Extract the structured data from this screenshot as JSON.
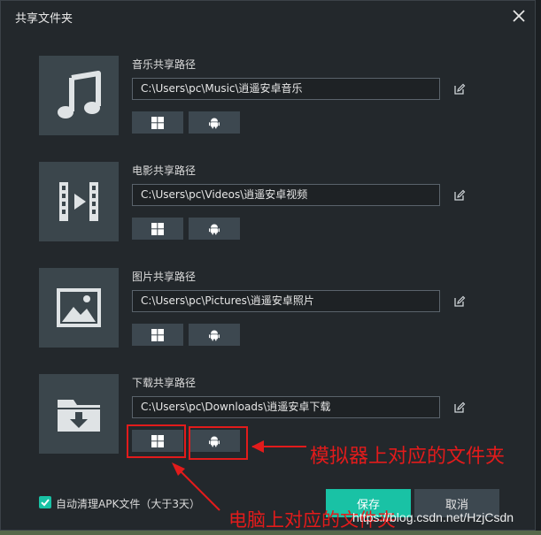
{
  "dialog": {
    "title": "共享文件夹"
  },
  "rows": [
    {
      "label": "音乐共享路径",
      "path": "C:\\Users\\pc\\Music\\逍遥安卓音乐",
      "icon": "music-note-icon"
    },
    {
      "label": "电影共享路径",
      "path": "C:\\Users\\pc\\Videos\\逍遥安卓视频",
      "icon": "film-icon"
    },
    {
      "label": "图片共享路径",
      "path": "C:\\Users\\pc\\Pictures\\逍遥安卓照片",
      "icon": "image-icon"
    },
    {
      "label": "下载共享路径",
      "path": "C:\\Users\\pc\\Downloads\\逍遥安卓下载",
      "icon": "download-folder-icon"
    }
  ],
  "footer": {
    "auto_clean_label": "自动清理APK文件（大于3天）",
    "auto_clean_checked": true,
    "save_label": "保存",
    "cancel_label": "取消"
  },
  "annotations": {
    "emulator_folder": "模拟器上对应的文件夹",
    "pc_folder": "电脑上对应的文件夹"
  },
  "watermark": "https://blog.csdn.net/HzjCsdn",
  "colors": {
    "accent": "#19c2a5",
    "annotation": "#e21b1b",
    "panel": "#23282c",
    "thumb": "#3b464c"
  }
}
